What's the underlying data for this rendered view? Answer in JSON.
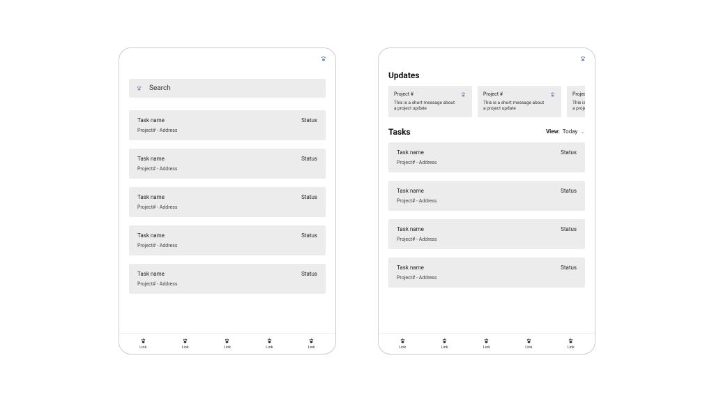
{
  "search": {
    "placeholder": "Search"
  },
  "tasks": [
    {
      "name": "Task name",
      "status": "Status",
      "sub": "Project# - Address"
    },
    {
      "name": "Task name",
      "status": "Status",
      "sub": "Project# - Address"
    },
    {
      "name": "Task name",
      "status": "Status",
      "sub": "Project# - Address"
    },
    {
      "name": "Task name",
      "status": "Status",
      "sub": "Project# - Address"
    },
    {
      "name": "Task name",
      "status": "Status",
      "sub": "Project# - Address"
    }
  ],
  "screen2": {
    "updates_title": "Updates",
    "updates": [
      {
        "title": "Project #",
        "msg": "This is a short message about a project update"
      },
      {
        "title": "Project #",
        "msg": "This is a short message about a project update"
      },
      {
        "title": "Project #",
        "msg": "This is a short message about a project update"
      }
    ],
    "tasks_title": "Tasks",
    "view_label": "View:",
    "view_value": "Today",
    "tasks": [
      {
        "name": "Task name",
        "status": "Status",
        "sub": "Project# - Address"
      },
      {
        "name": "Task name",
        "status": "Status",
        "sub": "Project# - Address"
      },
      {
        "name": "Task name",
        "status": "Status",
        "sub": "Project# - Address"
      },
      {
        "name": "Task name",
        "status": "Status",
        "sub": "Project# - Address"
      }
    ]
  },
  "nav": [
    {
      "label": "Link"
    },
    {
      "label": "Link"
    },
    {
      "label": "Link"
    },
    {
      "label": "Link"
    },
    {
      "label": "Link"
    }
  ]
}
